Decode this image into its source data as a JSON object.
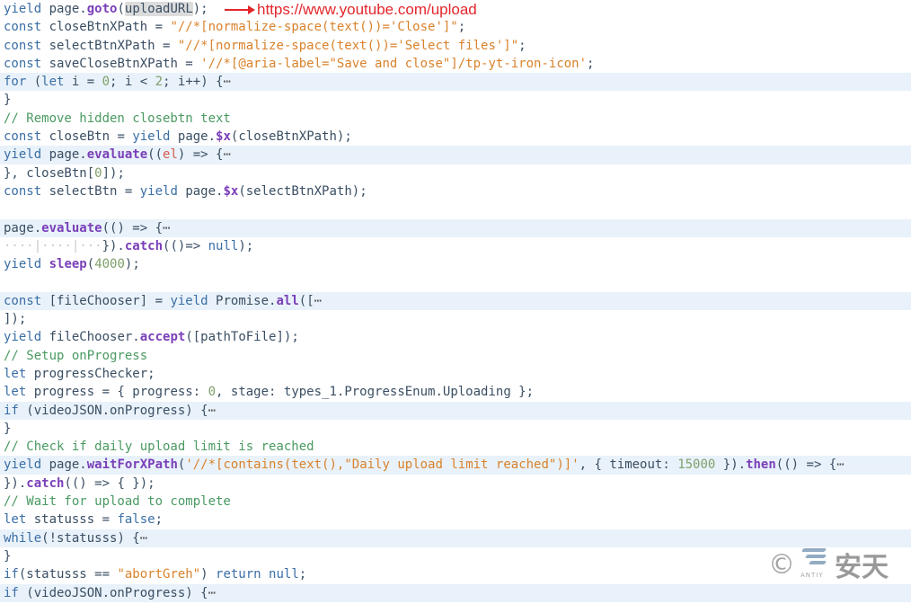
{
  "annotation": {
    "text": "https://www.youtube.com/upload",
    "color": "#e3262b"
  },
  "watermark": {
    "copyright": "©",
    "logo_small": "ANTIY",
    "logo_cn": "安天"
  },
  "lines": [
    {
      "fold": false,
      "tokens": [
        {
          "t": "yield",
          "c": "kw"
        },
        {
          "t": " page.",
          "c": "plain"
        },
        {
          "t": "goto",
          "c": "fn"
        },
        {
          "t": "(",
          "c": "plain"
        },
        {
          "t": "uploadURL",
          "c": "plain",
          "hl": true
        },
        {
          "t": ");",
          "c": "plain"
        }
      ]
    },
    {
      "fold": false,
      "tokens": [
        {
          "t": "const",
          "c": "kw"
        },
        {
          "t": " closeBtnXPath = ",
          "c": "plain"
        },
        {
          "t": "\"//*[normalize-space(text())='Close']\"",
          "c": "str"
        },
        {
          "t": ";",
          "c": "plain"
        }
      ]
    },
    {
      "fold": false,
      "tokens": [
        {
          "t": "const",
          "c": "kw"
        },
        {
          "t": " selectBtnXPath = ",
          "c": "plain"
        },
        {
          "t": "\"//*[normalize-space(text())='Select files']\"",
          "c": "str"
        },
        {
          "t": ";",
          "c": "plain"
        }
      ]
    },
    {
      "fold": false,
      "tokens": [
        {
          "t": "const",
          "c": "kw"
        },
        {
          "t": " saveCloseBtnXPath = ",
          "c": "plain"
        },
        {
          "t": "'//*[@aria-label=\"Save and close\"]/tp-yt-iron-icon'",
          "c": "str"
        },
        {
          "t": ";",
          "c": "plain"
        }
      ]
    },
    {
      "fold": true,
      "tokens": [
        {
          "t": "for",
          "c": "kw"
        },
        {
          "t": " (",
          "c": "plain"
        },
        {
          "t": "let",
          "c": "kw"
        },
        {
          "t": " i = ",
          "c": "plain"
        },
        {
          "t": "0",
          "c": "num"
        },
        {
          "t": "; i < ",
          "c": "plain"
        },
        {
          "t": "2",
          "c": "num"
        },
        {
          "t": "; i++) {",
          "c": "plain"
        },
        {
          "t": "⋯",
          "c": "ell"
        }
      ]
    },
    {
      "fold": false,
      "tokens": [
        {
          "t": "}",
          "c": "plain"
        }
      ]
    },
    {
      "fold": false,
      "tokens": [
        {
          "t": "// Remove hidden closebtn text",
          "c": "cm"
        }
      ]
    },
    {
      "fold": false,
      "tokens": [
        {
          "t": "const",
          "c": "kw"
        },
        {
          "t": " closeBtn = ",
          "c": "plain"
        },
        {
          "t": "yield",
          "c": "kw"
        },
        {
          "t": " page.",
          "c": "plain"
        },
        {
          "t": "$x",
          "c": "fn"
        },
        {
          "t": "(closeBtnXPath);",
          "c": "plain"
        }
      ]
    },
    {
      "fold": true,
      "tokens": [
        {
          "t": "yield",
          "c": "kw"
        },
        {
          "t": " page.",
          "c": "plain"
        },
        {
          "t": "evaluate",
          "c": "fn"
        },
        {
          "t": "((",
          "c": "plain"
        },
        {
          "t": "el",
          "c": "param"
        },
        {
          "t": ") => {",
          "c": "plain"
        },
        {
          "t": "⋯",
          "c": "ell"
        }
      ]
    },
    {
      "fold": false,
      "tokens": [
        {
          "t": "}, closeBtn[",
          "c": "plain"
        },
        {
          "t": "0",
          "c": "num"
        },
        {
          "t": "]);",
          "c": "plain"
        }
      ]
    },
    {
      "fold": false,
      "tokens": [
        {
          "t": "const",
          "c": "kw"
        },
        {
          "t": " selectBtn = ",
          "c": "plain"
        },
        {
          "t": "yield",
          "c": "kw"
        },
        {
          "t": " page.",
          "c": "plain"
        },
        {
          "t": "$x",
          "c": "fn"
        },
        {
          "t": "(selectBtnXPath);",
          "c": "plain"
        }
      ]
    },
    {
      "fold": false,
      "tokens": []
    },
    {
      "fold": true,
      "tokens": [
        {
          "t": "page.",
          "c": "plain"
        },
        {
          "t": "evaluate",
          "c": "fn"
        },
        {
          "t": "(() => {",
          "c": "plain"
        },
        {
          "t": "⋯",
          "c": "ell"
        }
      ]
    },
    {
      "fold": false,
      "tokens": [
        {
          "t": "····|····|···",
          "c": "ws"
        },
        {
          "t": "}).",
          "c": "plain"
        },
        {
          "t": "catch",
          "c": "fn"
        },
        {
          "t": "(()=> ",
          "c": "plain"
        },
        {
          "t": "null",
          "c": "kw"
        },
        {
          "t": ");",
          "c": "plain"
        }
      ]
    },
    {
      "fold": false,
      "tokens": [
        {
          "t": "yield",
          "c": "kw"
        },
        {
          "t": " ",
          "c": "plain"
        },
        {
          "t": "sleep",
          "c": "fn"
        },
        {
          "t": "(",
          "c": "plain"
        },
        {
          "t": "4000",
          "c": "num"
        },
        {
          "t": ");",
          "c": "plain"
        }
      ]
    },
    {
      "fold": false,
      "tokens": []
    },
    {
      "fold": true,
      "tokens": [
        {
          "t": "const",
          "c": "kw"
        },
        {
          "t": " [fileChooser] = ",
          "c": "plain"
        },
        {
          "t": "yield",
          "c": "kw"
        },
        {
          "t": " Promise.",
          "c": "plain"
        },
        {
          "t": "all",
          "c": "fn"
        },
        {
          "t": "([",
          "c": "plain"
        },
        {
          "t": "⋯",
          "c": "ell"
        }
      ]
    },
    {
      "fold": false,
      "tokens": [
        {
          "t": "]);",
          "c": "plain"
        }
      ]
    },
    {
      "fold": false,
      "tokens": [
        {
          "t": "yield",
          "c": "kw"
        },
        {
          "t": " fileChooser.",
          "c": "plain"
        },
        {
          "t": "accept",
          "c": "fn"
        },
        {
          "t": "([pathToFile]);",
          "c": "plain"
        }
      ]
    },
    {
      "fold": false,
      "tokens": [
        {
          "t": "// Setup onProgress",
          "c": "cm"
        }
      ]
    },
    {
      "fold": false,
      "tokens": [
        {
          "t": "let",
          "c": "kw"
        },
        {
          "t": " progressChecker;",
          "c": "plain"
        }
      ]
    },
    {
      "fold": false,
      "tokens": [
        {
          "t": "let",
          "c": "kw"
        },
        {
          "t": " progress = { progress: ",
          "c": "plain"
        },
        {
          "t": "0",
          "c": "num"
        },
        {
          "t": ", stage: types_1.ProgressEnum.Uploading };",
          "c": "plain"
        }
      ]
    },
    {
      "fold": true,
      "tokens": [
        {
          "t": "if",
          "c": "kw"
        },
        {
          "t": " (videoJSON.onProgress) {",
          "c": "plain"
        },
        {
          "t": "⋯",
          "c": "ell"
        }
      ]
    },
    {
      "fold": false,
      "tokens": [
        {
          "t": "}",
          "c": "plain"
        }
      ]
    },
    {
      "fold": false,
      "tokens": [
        {
          "t": "// Check if daily upload limit is reached",
          "c": "cm"
        }
      ]
    },
    {
      "fold": true,
      "tokens": [
        {
          "t": "yield",
          "c": "kw"
        },
        {
          "t": " page.",
          "c": "plain"
        },
        {
          "t": "waitForXPath",
          "c": "fn"
        },
        {
          "t": "(",
          "c": "plain"
        },
        {
          "t": "'//*[contains(text(),\"Daily upload limit reached\")]'",
          "c": "str"
        },
        {
          "t": ", { timeout: ",
          "c": "plain"
        },
        {
          "t": "15000",
          "c": "num"
        },
        {
          "t": " }).",
          "c": "plain"
        },
        {
          "t": "then",
          "c": "fn"
        },
        {
          "t": "(() => {",
          "c": "plain"
        },
        {
          "t": "⋯",
          "c": "ell"
        }
      ]
    },
    {
      "fold": false,
      "tokens": [
        {
          "t": "}).",
          "c": "plain"
        },
        {
          "t": "catch",
          "c": "fn"
        },
        {
          "t": "(() => { });",
          "c": "plain"
        }
      ]
    },
    {
      "fold": false,
      "tokens": [
        {
          "t": "// Wait for upload to complete",
          "c": "cm"
        }
      ]
    },
    {
      "fold": false,
      "tokens": [
        {
          "t": "let",
          "c": "kw"
        },
        {
          "t": " statusss = ",
          "c": "plain"
        },
        {
          "t": "false",
          "c": "kw"
        },
        {
          "t": ";",
          "c": "plain"
        }
      ]
    },
    {
      "fold": true,
      "tokens": [
        {
          "t": "while",
          "c": "kw"
        },
        {
          "t": "(!statusss) {",
          "c": "plain"
        },
        {
          "t": "⋯",
          "c": "ell"
        }
      ]
    },
    {
      "fold": false,
      "tokens": [
        {
          "t": "}",
          "c": "plain"
        }
      ]
    },
    {
      "fold": false,
      "tokens": [
        {
          "t": "if",
          "c": "kw"
        },
        {
          "t": "(statusss == ",
          "c": "plain"
        },
        {
          "t": "\"abortGreh\"",
          "c": "str"
        },
        {
          "t": ") ",
          "c": "plain"
        },
        {
          "t": "return",
          "c": "kw"
        },
        {
          "t": " ",
          "c": "plain"
        },
        {
          "t": "null",
          "c": "kw"
        },
        {
          "t": ";",
          "c": "plain"
        }
      ]
    },
    {
      "fold": true,
      "tokens": [
        {
          "t": "if",
          "c": "kw"
        },
        {
          "t": " (videoJSON.onProgress) {",
          "c": "plain"
        },
        {
          "t": "⋯",
          "c": "ell"
        }
      ]
    }
  ]
}
